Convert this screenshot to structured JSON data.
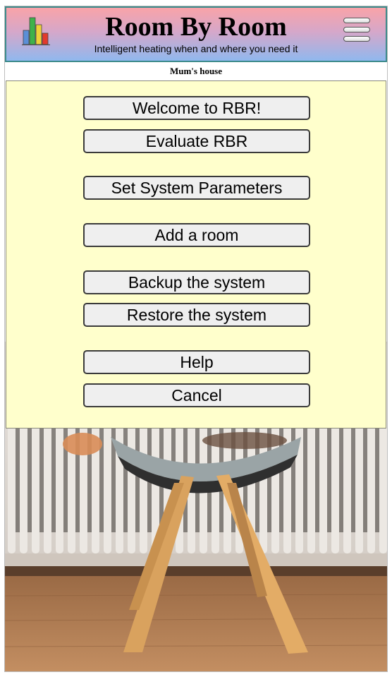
{
  "header": {
    "title": "Room By Room",
    "subtitle": "Intelligent heating when and where you need it",
    "logo_icon": "bar-chart-logo-icon",
    "menu_icon": "hamburger-menu-icon"
  },
  "location": {
    "name": "Mum's house"
  },
  "menu": {
    "items": [
      {
        "label": "Welcome to RBR!"
      },
      {
        "label": "Evaluate RBR"
      },
      {
        "label": "Set System Parameters"
      },
      {
        "label": "Add a room"
      },
      {
        "label": "Backup the system"
      },
      {
        "label": "Restore the system"
      },
      {
        "label": "Help"
      },
      {
        "label": "Cancel"
      }
    ]
  },
  "colors": {
    "header_top": "#f9a3a8",
    "header_bottom": "#90b8ee",
    "panel_bg": "#ffffcc",
    "button_bg": "#efefef"
  }
}
